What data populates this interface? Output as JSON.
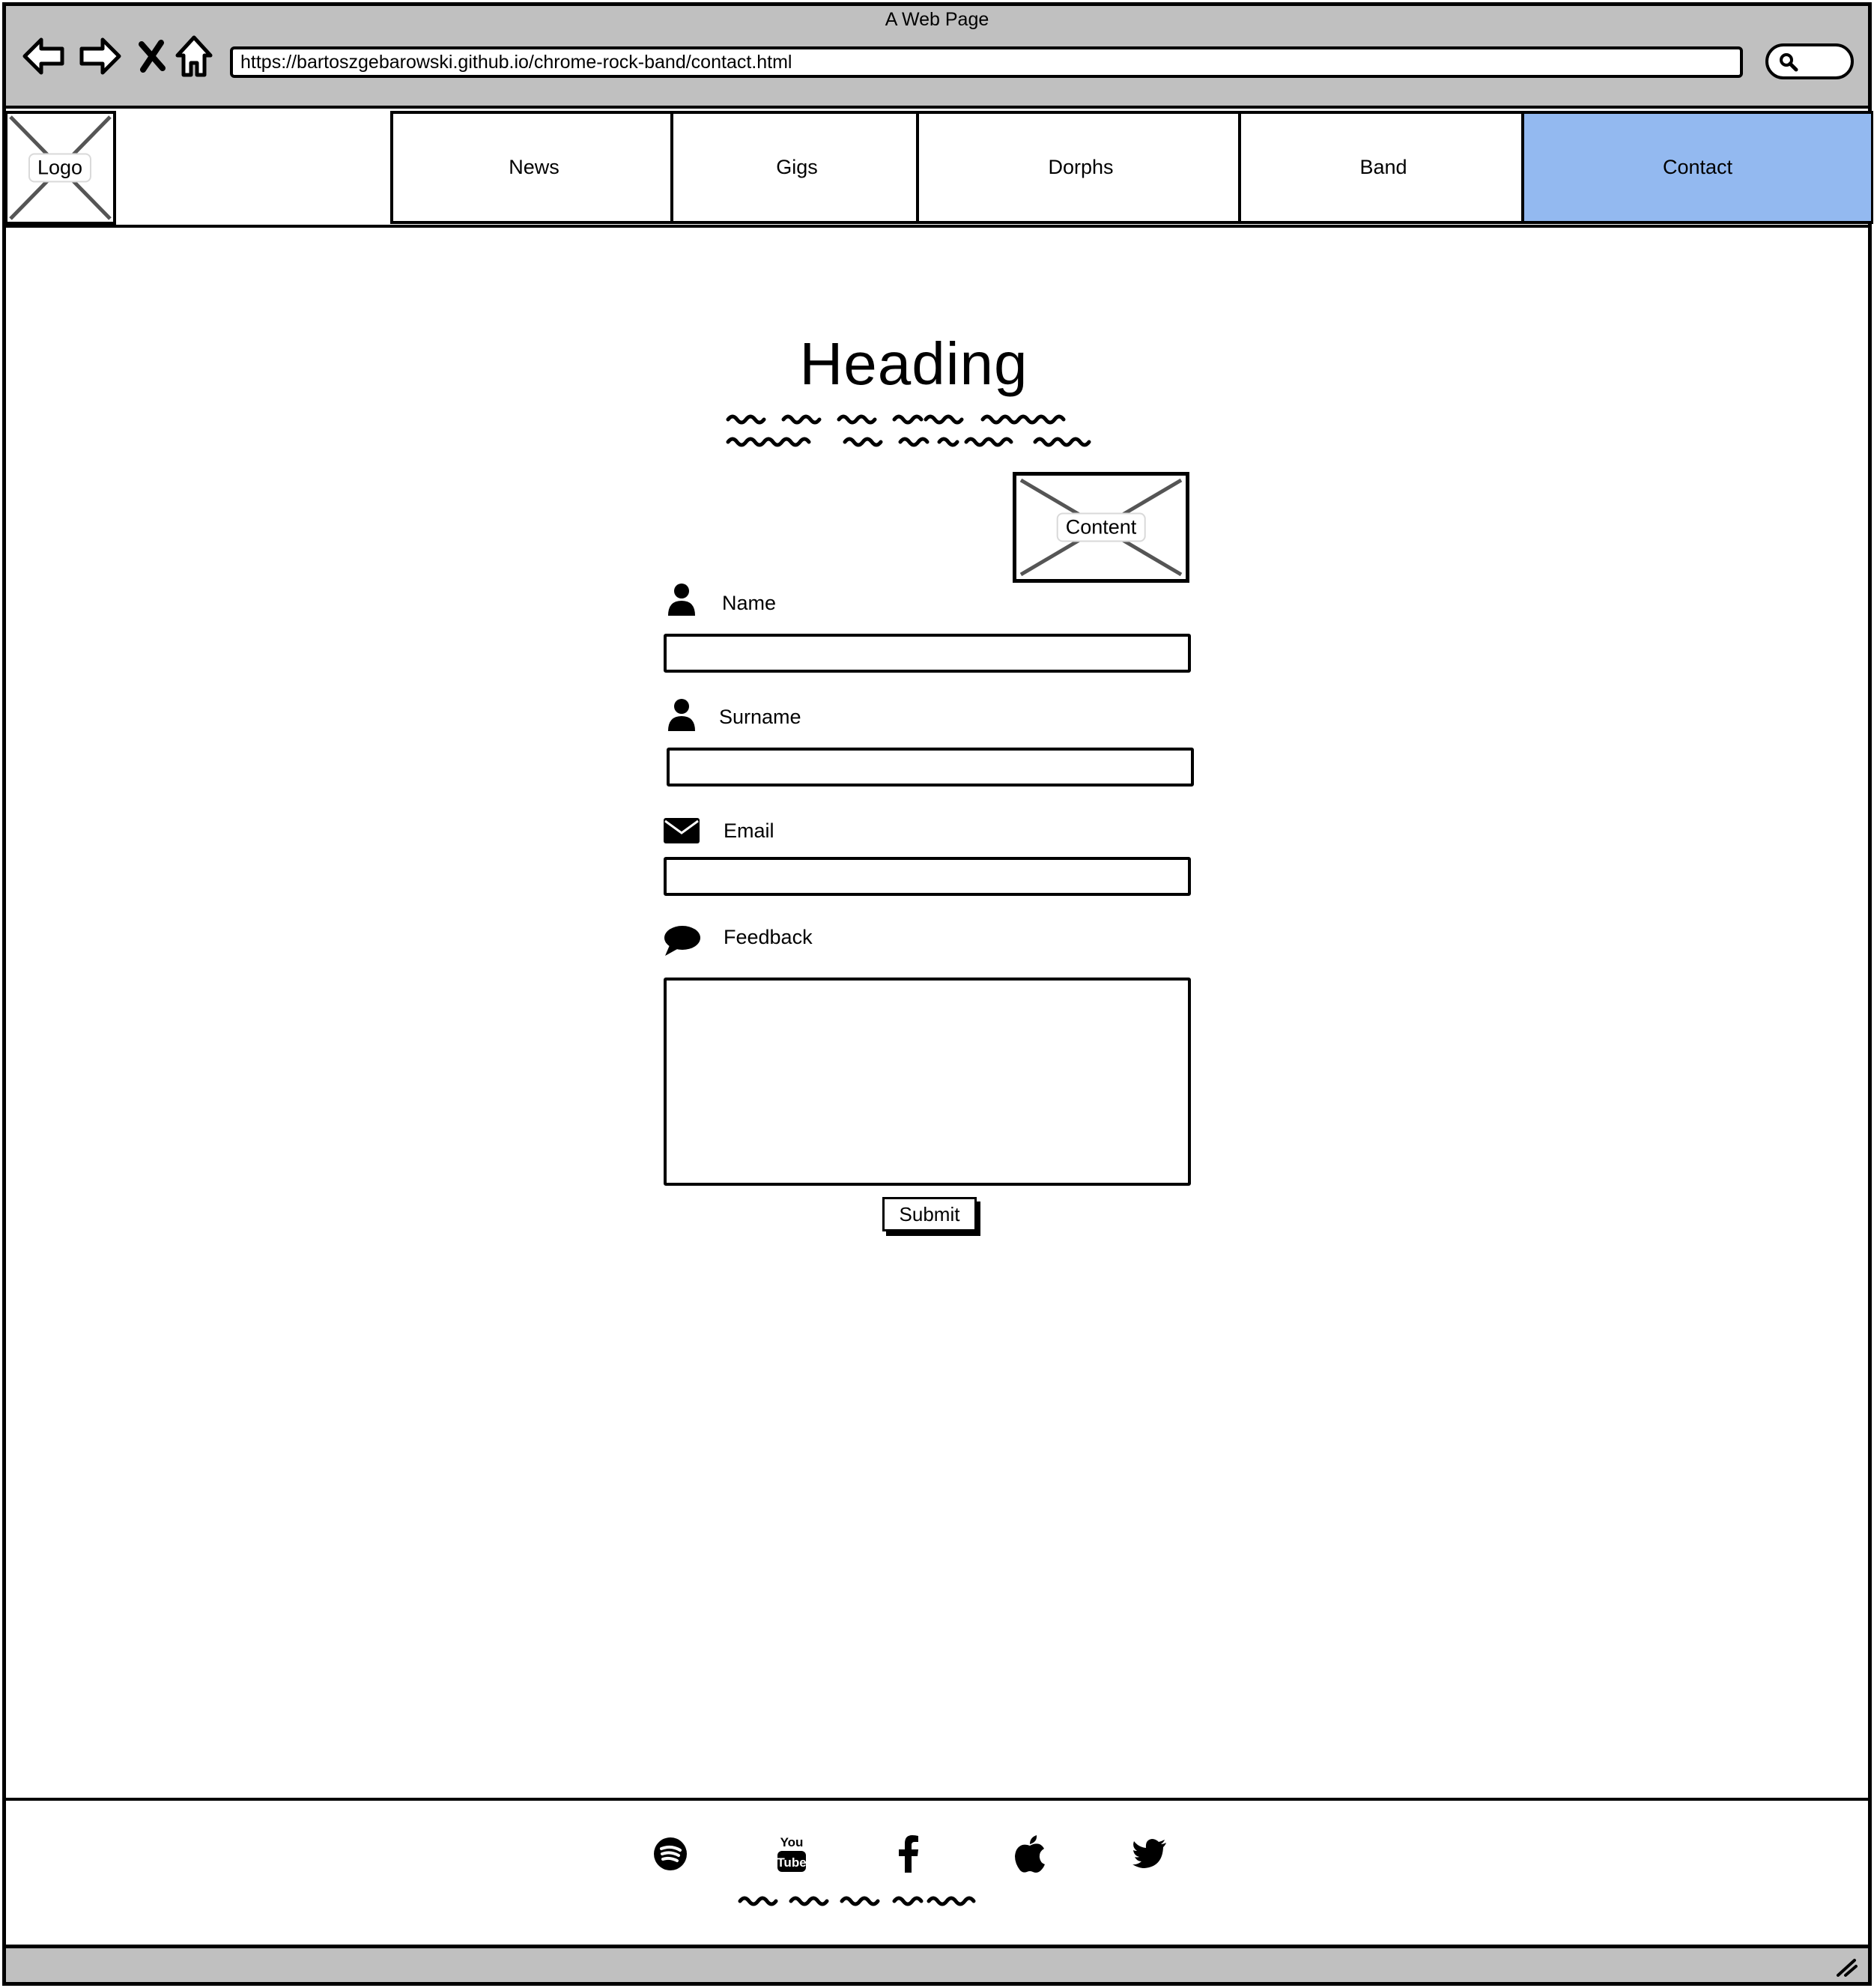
{
  "window": {
    "title": "A Web Page"
  },
  "browser": {
    "url": "https://bartoszgebarowski.github.io/chrome-rock-band/contact.html",
    "nav_icons": [
      "back-arrow-icon",
      "forward-arrow-icon",
      "stop-icon",
      "home-icon"
    ],
    "search_icon": "search-icon"
  },
  "header": {
    "logo_label": "Logo",
    "nav": [
      {
        "label": "News",
        "active": false
      },
      {
        "label": "Gigs",
        "active": false
      },
      {
        "label": "Dorphs",
        "active": false
      },
      {
        "label": "Band",
        "active": false
      },
      {
        "label": "Contact",
        "active": true
      }
    ],
    "active_color": "#93b9f0"
  },
  "main": {
    "heading": "Heading",
    "image_label": "Content",
    "form": {
      "name_label": "Name",
      "surname_label": "Surname",
      "email_label": "Email",
      "feedback_label": "Feedback",
      "name_value": "",
      "surname_value": "",
      "email_value": "",
      "feedback_value": "",
      "submit_label": "Submit"
    }
  },
  "footer": {
    "social_icons": [
      "spotify-icon",
      "youtube-icon",
      "facebook-icon",
      "apple-icon",
      "twitter-icon"
    ]
  },
  "colors": {
    "chrome_gray": "#c0c0c0",
    "accent_blue": "#93b9f0"
  }
}
